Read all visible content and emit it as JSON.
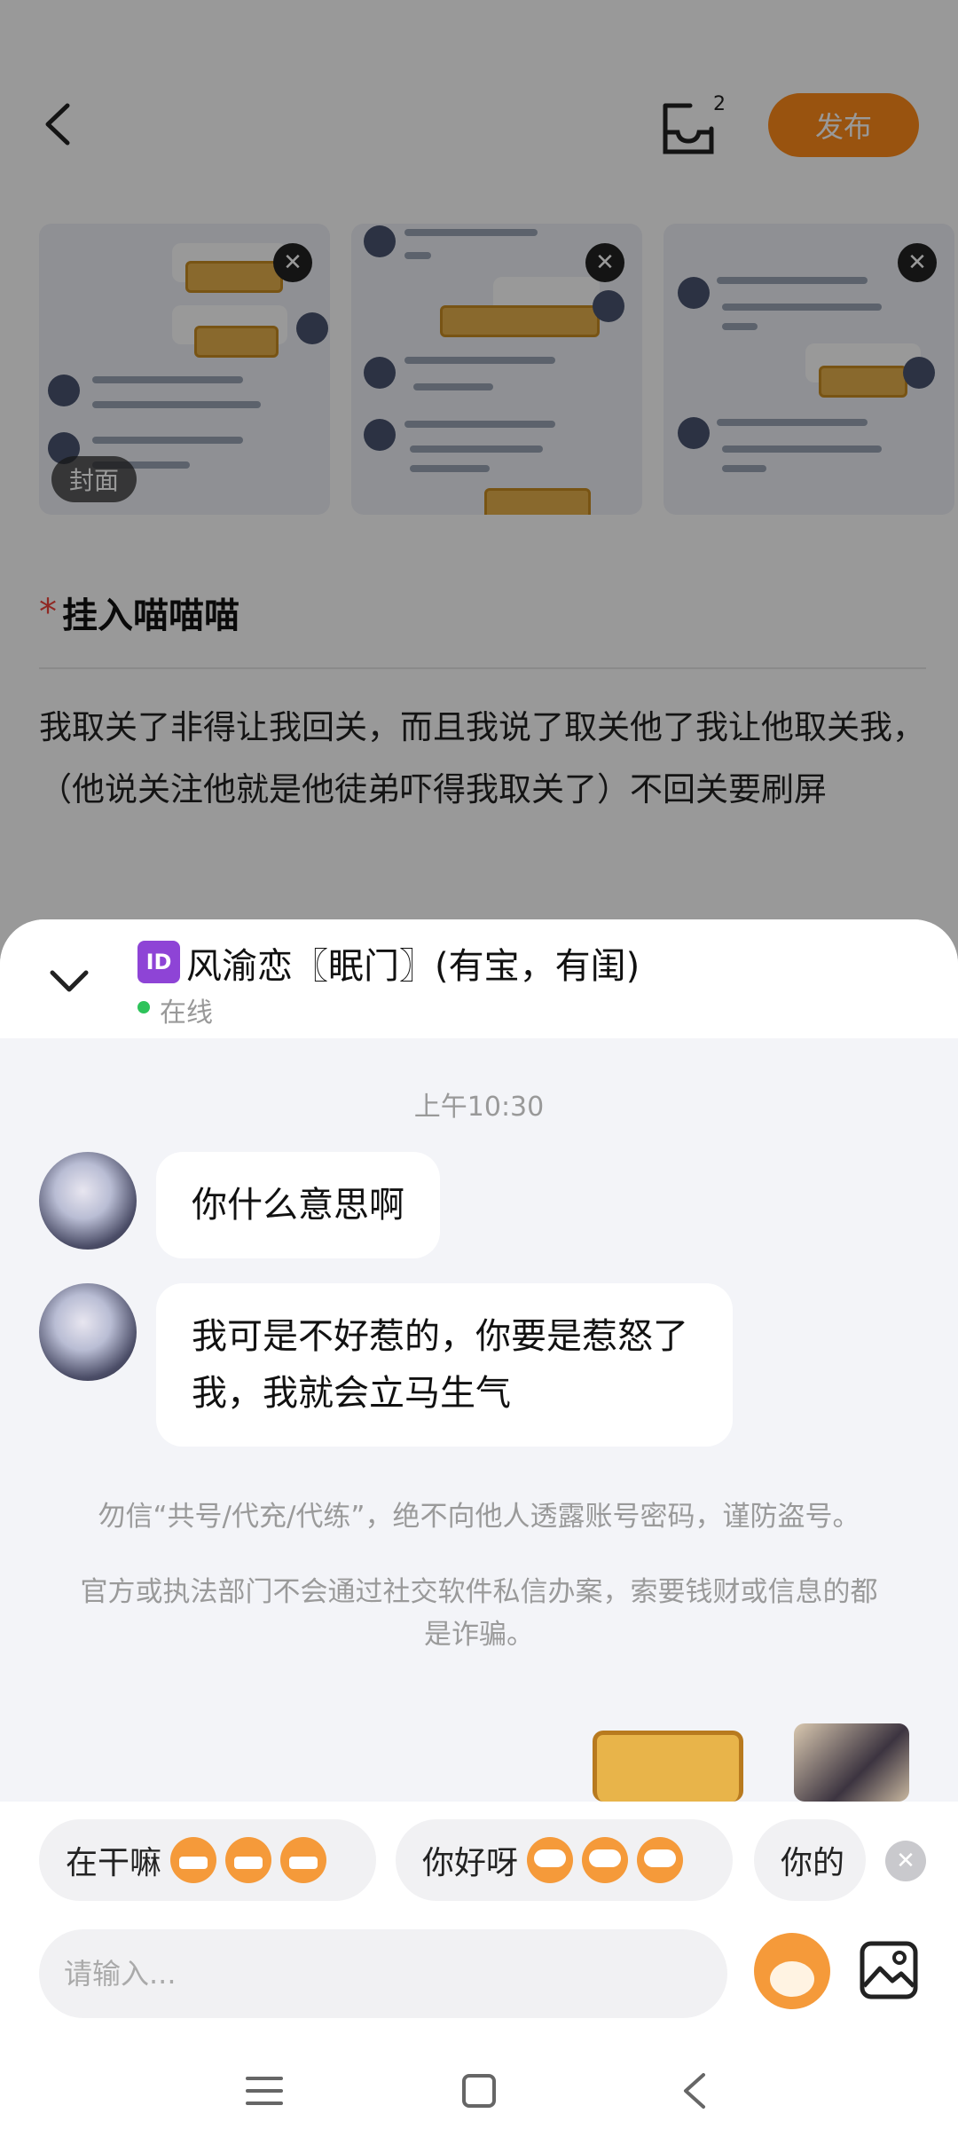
{
  "editor": {
    "draft_count": "2",
    "publish_label": "发布",
    "cover_label": "封面",
    "required_mark": "*",
    "title": "挂入喵喵喵",
    "body": "我取关了非得让我回关，而且我说了取关他了我让他取关我，（他说关注他就是他徒弟吓得我取关了）不回关要刷屏"
  },
  "chat": {
    "id_badge": "ID",
    "contact_name": "风渝恋〖眠门〗(有宝，有闺)",
    "status": "在线",
    "timestamp": "上午10:30",
    "messages": [
      {
        "text": "你什么意思啊"
      },
      {
        "text": "我可是不好惹的，你要是惹怒了我，我就会立马生气"
      }
    ],
    "notices": [
      "勿信“共号/代充/代练”，绝不向他人透露账号密码，谨防盗号。",
      "官方或执法部门不会通过社交软件私信办案，索要钱财或信息的都是诈骗。"
    ],
    "quick_replies": [
      "在干嘛",
      "你好呀",
      "你的"
    ],
    "input_placeholder": "请输入..."
  },
  "colors": {
    "accent": "#ff8a1a",
    "online": "#2ec35a",
    "required": "#f0443b",
    "id_badge": "#8e44d6"
  },
  "icons": [
    "back-arrow-icon",
    "drafts-tray-icon",
    "close-icon",
    "chevron-down-icon",
    "emoji-sticker-icon",
    "image-icon",
    "menu-icon",
    "home-square-icon",
    "back-triangle-icon"
  ]
}
